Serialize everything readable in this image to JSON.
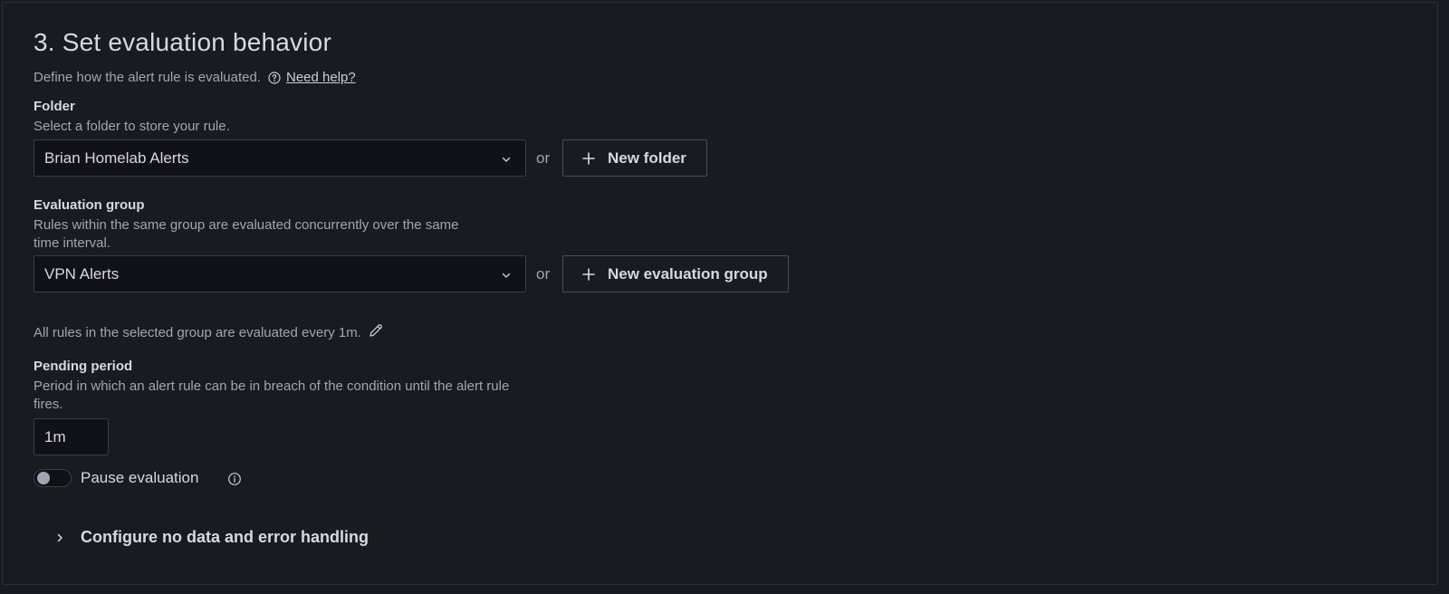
{
  "section": {
    "title": "3. Set evaluation behavior",
    "subtitle": "Define how the alert rule is evaluated.",
    "help_link": "Need help?"
  },
  "folder": {
    "label": "Folder",
    "description": "Select a folder to store your rule.",
    "selected_value": "Brian Homelab Alerts",
    "or_text": "or",
    "new_button": "New folder"
  },
  "evaluation_group": {
    "label": "Evaluation group",
    "description_line1": "Rules within the same group are evaluated concurrently over the same",
    "description_line2": "time interval.",
    "selected_value": "VPN Alerts",
    "or_text": "or",
    "new_button": "New evaluation group",
    "interval_text": "All rules in the selected group are evaluated every 1m."
  },
  "pending_period": {
    "label": "Pending period",
    "description_line1": "Period in which an alert rule can be in breach of the condition until the alert rule",
    "description_line2": "fires.",
    "value": "1m"
  },
  "pause": {
    "label": "Pause evaluation",
    "enabled": false
  },
  "collapse_section": {
    "label": "Configure no data and error handling"
  },
  "icons": {
    "help": "question-circle-icon",
    "chevron": "chevron-down-icon",
    "plus": "plus-icon",
    "pencil": "pencil-icon",
    "info": "info-circle-icon",
    "expand": "chevron-right-icon"
  },
  "colors": {
    "background": "#181b1f",
    "input_background": "#111217",
    "border": "#3a3d44",
    "text_primary": "#d8d9e0",
    "text_secondary": "#9fa7b3"
  }
}
